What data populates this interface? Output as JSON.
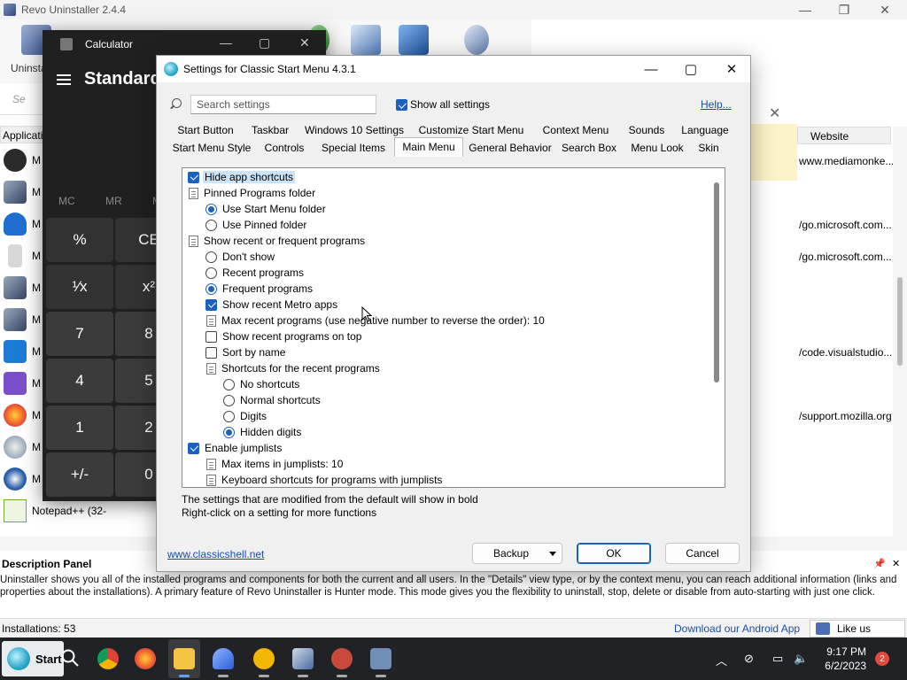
{
  "revo": {
    "title": "Revo Uninstaller 2.4.4",
    "uninstaller_label": "Uninsta",
    "search_placeholder": "Se",
    "column_application": "Applicati",
    "column_website": "Website",
    "row_labels": [
      "M",
      "M",
      "M",
      "M",
      "M",
      "M",
      "M",
      "M",
      "M",
      "M",
      "M"
    ],
    "notepad_label": "Notepad++ (32-",
    "websites": [
      "www.mediamonke...",
      "/go.microsoft.com...",
      "/go.microsoft.com...",
      "/code.visualstudio....",
      "/support.mozilla.org"
    ],
    "description_head": "Description Panel",
    "description_text": "Uninstaller shows you all of the installed programs and components for both the current and all users. In the \"Details\" view type, or by the context menu, you can reach additional information (links and properties about the installations). A primary feature of Revo Uninstaller is Hunter mode. This mode gives you the flexibility to uninstall, stop, delete or disable from auto-starting with just one click.",
    "installations": "Installations: 53",
    "android_link": "Download our Android App",
    "like_us": "Like us"
  },
  "calculator": {
    "title": "Calculator",
    "mode": "Standard",
    "memory": [
      "MC",
      "MR",
      "M"
    ],
    "buttons": [
      {
        "label": "%",
        "row": 0,
        "col": 0,
        "kind": "fn"
      },
      {
        "label": "CE",
        "row": 0,
        "col": 1,
        "kind": "fn"
      },
      {
        "label": "¹⁄x",
        "row": 1,
        "col": 0,
        "kind": "fn"
      },
      {
        "label": "x²",
        "row": 1,
        "col": 1,
        "kind": "fn"
      },
      {
        "label": "7",
        "row": 2,
        "col": 0,
        "kind": "num"
      },
      {
        "label": "8",
        "row": 2,
        "col": 1,
        "kind": "num"
      },
      {
        "label": "4",
        "row": 3,
        "col": 0,
        "kind": "num"
      },
      {
        "label": "5",
        "row": 3,
        "col": 1,
        "kind": "num"
      },
      {
        "label": "1",
        "row": 4,
        "col": 0,
        "kind": "num"
      },
      {
        "label": "2",
        "row": 4,
        "col": 1,
        "kind": "num"
      },
      {
        "label": "+/-",
        "row": 5,
        "col": 0,
        "kind": "num"
      },
      {
        "label": "0",
        "row": 5,
        "col": 1,
        "kind": "num"
      }
    ]
  },
  "dialog": {
    "title": "Settings for Classic Start Menu 4.3.1",
    "search_placeholder": "Search settings",
    "show_all_label": "Show all settings",
    "show_all_checked": true,
    "help_label": "Help...",
    "tabs_row1": [
      "Start Button",
      "Taskbar",
      "Windows 10 Settings",
      "Customize Start Menu",
      "Context Menu",
      "Sounds",
      "Language"
    ],
    "tabs_row2": [
      "Start Menu Style",
      "Controls",
      "Special Items",
      "Main Menu",
      "General Behavior",
      "Search Box",
      "Menu Look",
      "Skin"
    ],
    "active_tab": "Main Menu",
    "tree": [
      {
        "label": "Hide app shortcuts",
        "type": "checkbox",
        "checked": true,
        "indent": 0,
        "selected": true
      },
      {
        "label": "Pinned Programs folder",
        "type": "doc",
        "indent": 0
      },
      {
        "label": "Use Start Menu folder",
        "type": "radio",
        "checked": true,
        "indent": 1
      },
      {
        "label": "Use Pinned folder",
        "type": "radio",
        "checked": false,
        "indent": 1
      },
      {
        "label": "Show recent or frequent programs",
        "type": "doc",
        "indent": 0
      },
      {
        "label": "Don't show",
        "type": "radio",
        "checked": false,
        "indent": 1
      },
      {
        "label": "Recent programs",
        "type": "radio",
        "checked": false,
        "indent": 1
      },
      {
        "label": "Frequent programs",
        "type": "radio",
        "checked": true,
        "indent": 1
      },
      {
        "label": "Show recent Metro apps",
        "type": "checkbox",
        "checked": true,
        "indent": 1
      },
      {
        "label": "Max recent programs (use negative number to reverse the order): 10",
        "type": "doc",
        "indent": 1
      },
      {
        "label": "Show recent programs on top",
        "type": "checkbox",
        "checked": false,
        "indent": 1
      },
      {
        "label": "Sort by name",
        "type": "checkbox",
        "checked": false,
        "indent": 1
      },
      {
        "label": "Shortcuts for the recent programs",
        "type": "doc",
        "indent": 1
      },
      {
        "label": "No shortcuts",
        "type": "radio",
        "checked": false,
        "indent": 2
      },
      {
        "label": "Normal shortcuts",
        "type": "radio",
        "checked": false,
        "indent": 2
      },
      {
        "label": "Digits",
        "type": "radio",
        "checked": false,
        "indent": 2
      },
      {
        "label": "Hidden digits",
        "type": "radio",
        "checked": true,
        "indent": 2
      },
      {
        "label": "Enable jumplists",
        "type": "checkbox",
        "checked": true,
        "indent": 0
      },
      {
        "label": "Max items in jumplists: 10",
        "type": "doc",
        "indent": 1
      },
      {
        "label": "Keyboard shortcuts for programs with jumplists",
        "type": "doc",
        "indent": 1
      }
    ],
    "hint_line1": "The settings that are modified from the default will show in bold",
    "hint_line2": "Right-click on a setting for more functions",
    "website": "www.classicshell.net",
    "backup_label": "Backup",
    "ok_label": "OK",
    "cancel_label": "Cancel"
  },
  "taskbar": {
    "start_label": "Start",
    "time": "9:17 PM",
    "date": "6/2/2023",
    "notifications": "2"
  }
}
